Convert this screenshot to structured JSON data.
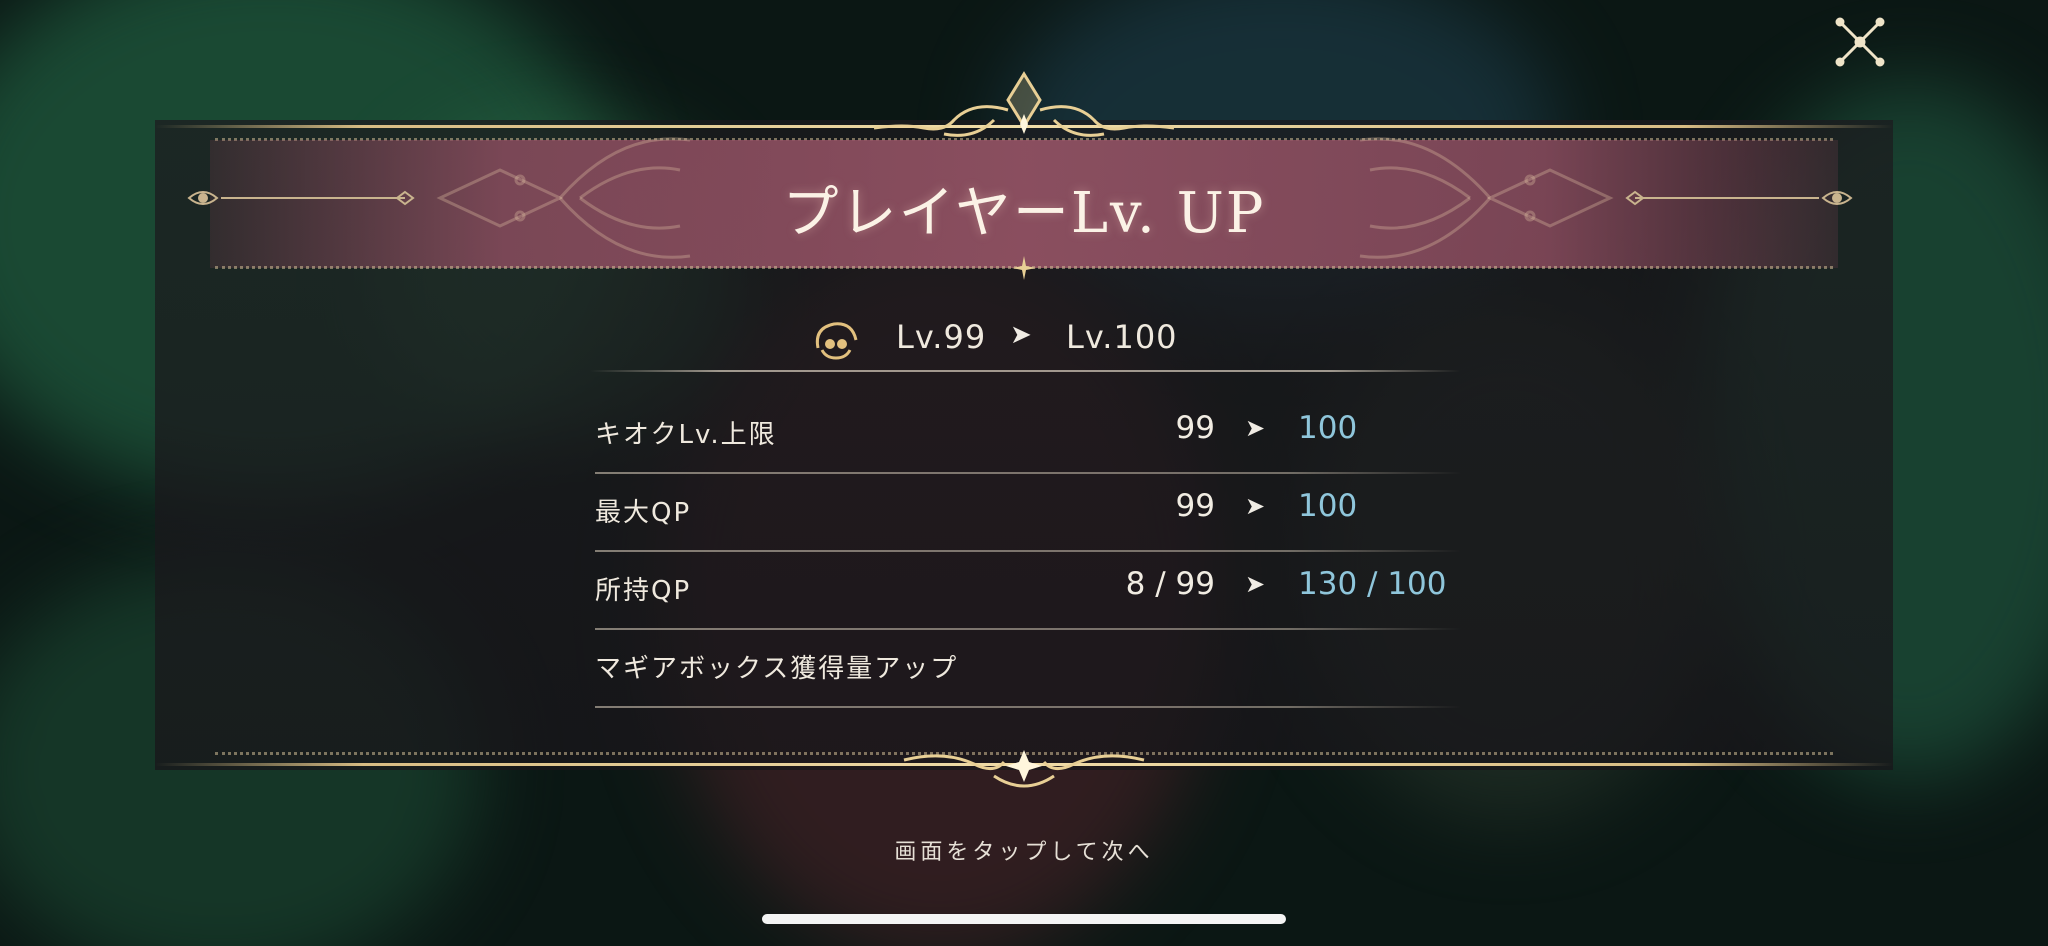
{
  "dialog": {
    "title": "プレイヤーLv. UP",
    "close_icon": "close-x-icon"
  },
  "level": {
    "icon": "player-avatar-icon",
    "from": "Lv.99",
    "arrow": "➤",
    "to": "Lv.100"
  },
  "stats": [
    {
      "label": "キオクLv.上限",
      "from": "99",
      "to": "100"
    },
    {
      "label": "最大QP",
      "from": "99",
      "to": "100"
    },
    {
      "label": "所持QP",
      "from": "8 / 99",
      "to": "130 / 100"
    },
    {
      "label": "マギアボックス獲得量アップ",
      "from": "",
      "to": ""
    }
  ],
  "arrow_glyph": "➤",
  "footer": {
    "tap_hint": "画面をタップして次へ"
  },
  "colors": {
    "accent_gold": "#d8bd84",
    "title_band": "#96546a",
    "new_value_blue": "#8fc6db"
  }
}
